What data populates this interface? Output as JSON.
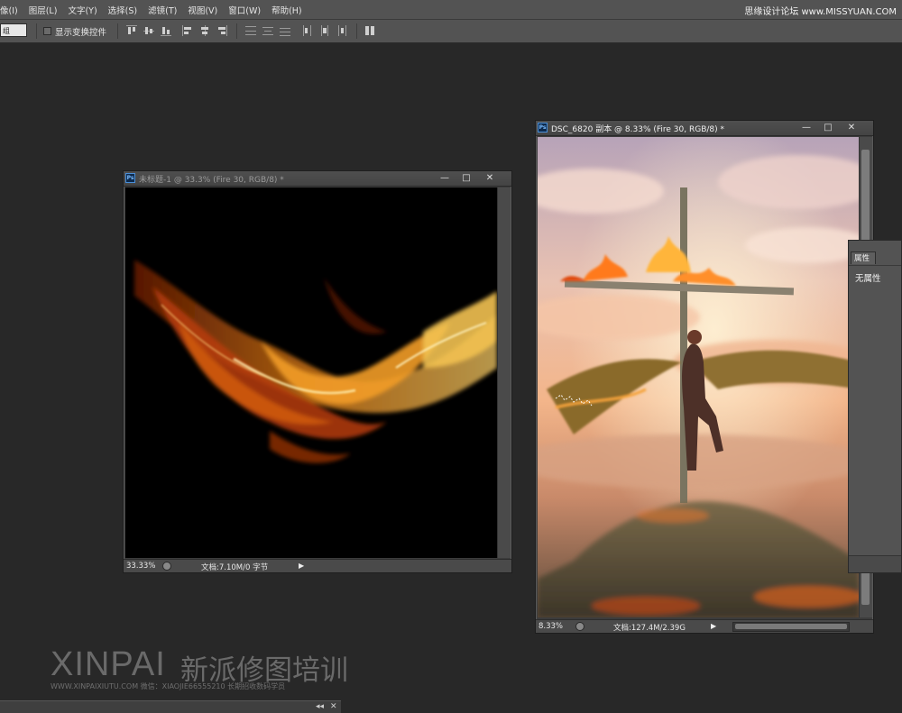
{
  "menubar": {
    "items": [
      "像(I)",
      "图层(L)",
      "文字(Y)",
      "选择(S)",
      "滤镜(T)",
      "视图(V)",
      "窗口(W)",
      "帮助(H)"
    ],
    "watermark": "思缘设计论坛 www.MISSYUAN.COM"
  },
  "optionsbar": {
    "select_value": "组",
    "show_transform_label": "显示变换控件",
    "show_transform_checked": false
  },
  "doc1": {
    "title": "未标题-1 @ 33.3% (Fire 30, RGB/8) *",
    "zoom": "33.33%",
    "doc_info": "文档:7.10M/0 字节"
  },
  "doc2": {
    "title": "DSC_6820 副本 @ 8.33% (Fire 30, RGB/8) *",
    "zoom": "8.33%",
    "doc_info": "文档:127.4M/2.39G"
  },
  "properties": {
    "tab_label": "属性",
    "value": "无属性"
  },
  "branding": {
    "logo": "XINPAI",
    "logo_cn": "新派修图培训",
    "subtitle": "WWW.XINPAIXIUTU.COM  微信：XIAOJIE66555210 长期招收数码学员"
  },
  "icons": {
    "ps": "Ps",
    "minimize": "—",
    "maximize": "□",
    "close": "✕",
    "play": "▶",
    "collapse": "◂◂",
    "panel_close": "✕"
  }
}
